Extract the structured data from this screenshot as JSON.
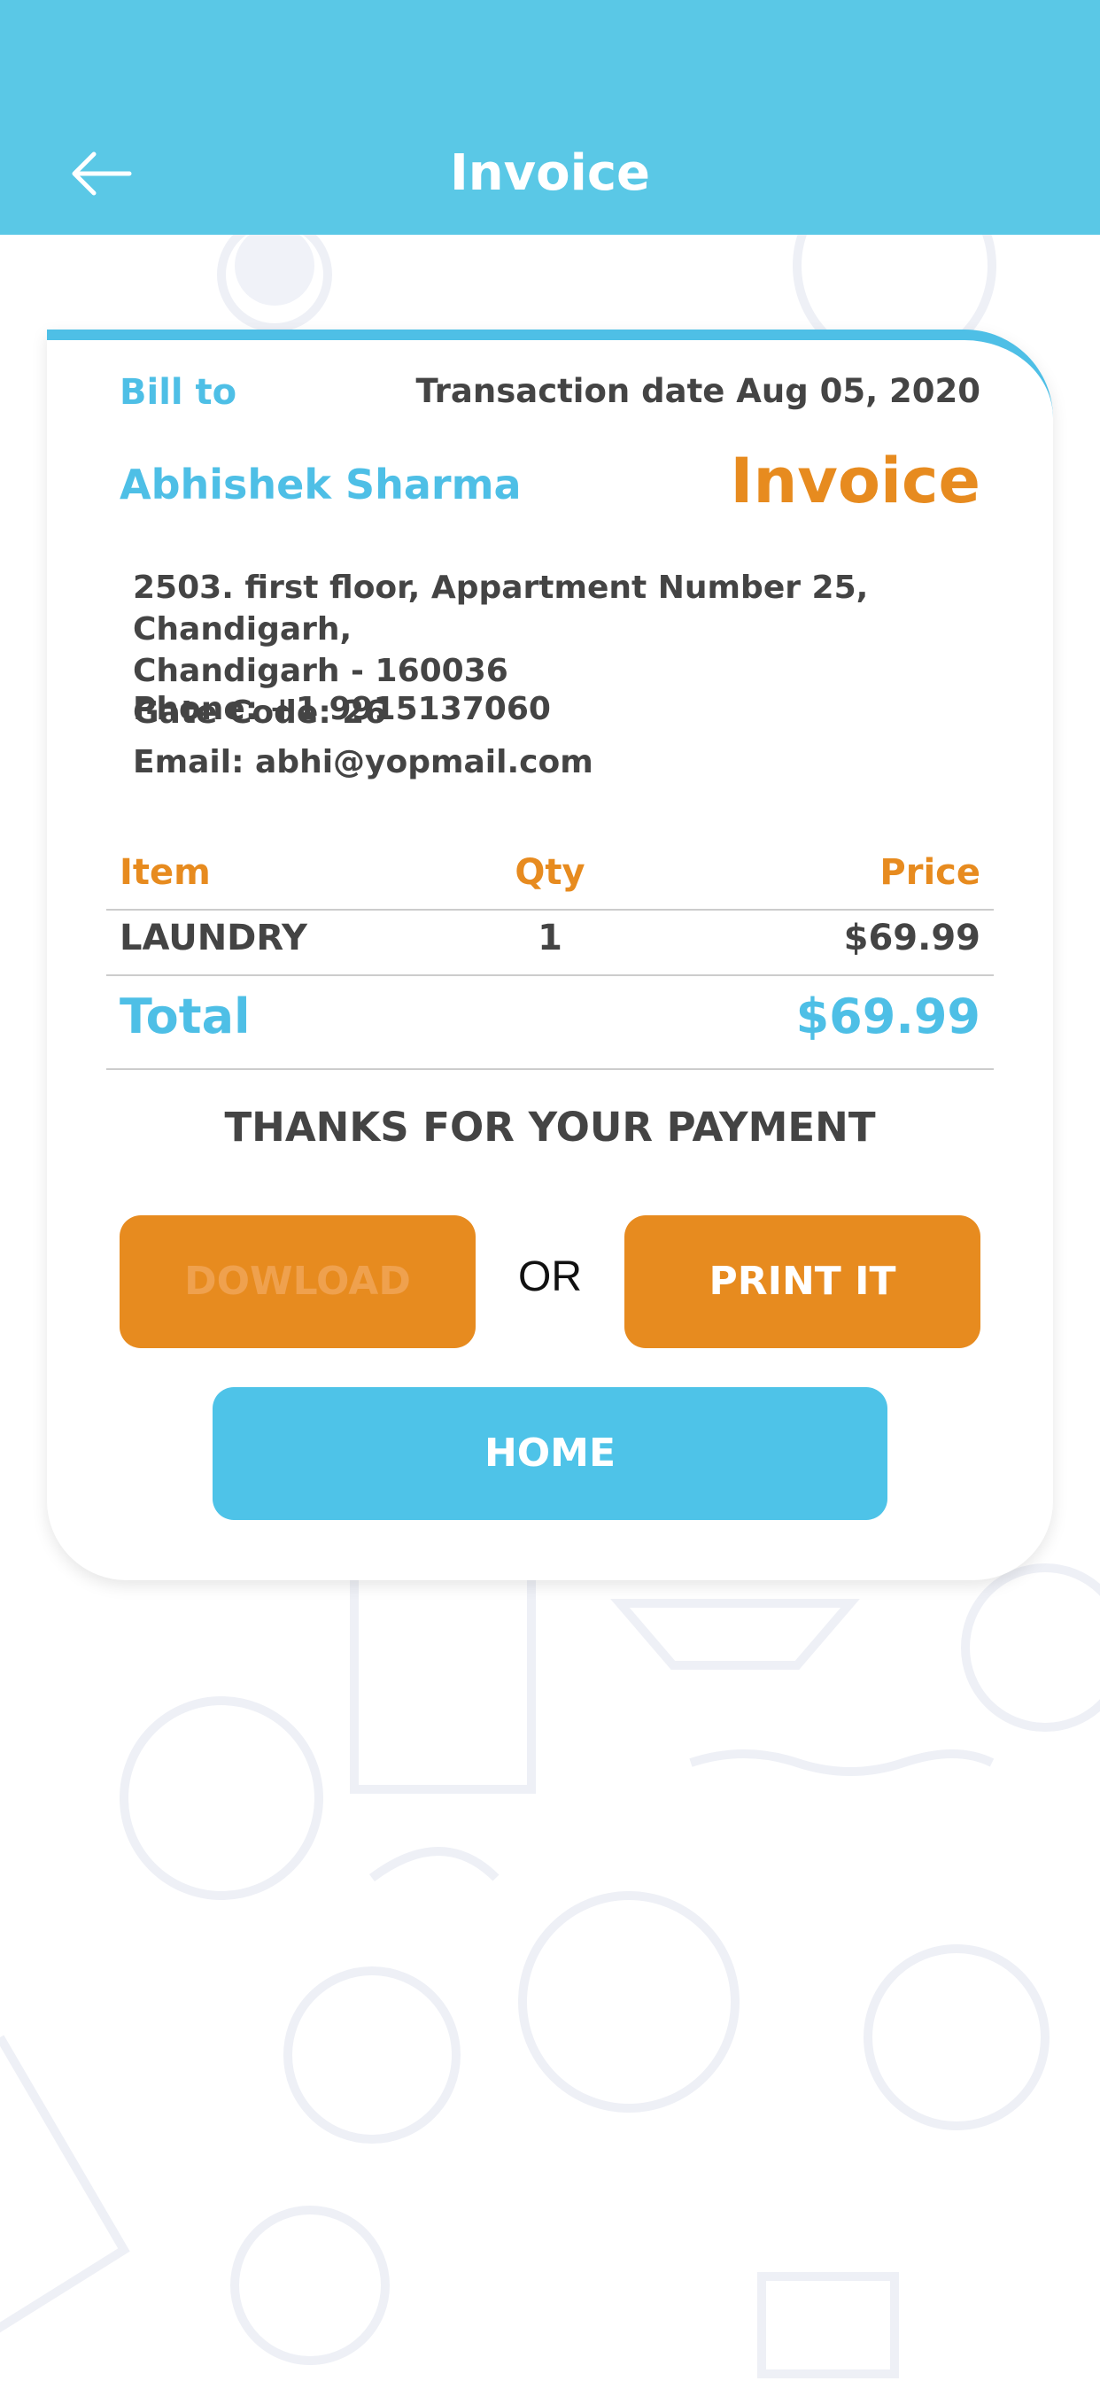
{
  "header": {
    "title": "Invoice",
    "back_icon": "arrow-left-icon",
    "background_color": "#5ac8e6"
  },
  "invoice": {
    "bill_to_label": "Bill to",
    "transaction_date": "Transaction date Aug 05, 2020",
    "customer_name": "Abhishek Sharma",
    "invoice_label": "Invoice",
    "address_line1": "2503. first floor, Appartment Number 25, Chandigarh,",
    "address_line2": "Chandigarh - 160036",
    "gate_code": "Gate Code: 26",
    "phone": "Phone: +1 9915137060",
    "email": "Email: abhi@yopmail.com"
  },
  "table": {
    "headers": {
      "item": "Item",
      "qty": "Qty",
      "price": "Price"
    },
    "rows": [
      {
        "item": "LAUNDRY",
        "qty": "1",
        "price": "$69.99"
      }
    ],
    "total_label": "Total",
    "total_value": "$69.99"
  },
  "thanks_message": "THANKS FOR YOUR PAYMENT",
  "buttons": {
    "download": "DOWLOAD",
    "or": "OR",
    "print": "PRINT IT",
    "home": "HOME"
  },
  "colors": {
    "accent_blue": "#4ebfe6",
    "accent_orange": "#e78b1f",
    "text_dark": "#444444"
  }
}
